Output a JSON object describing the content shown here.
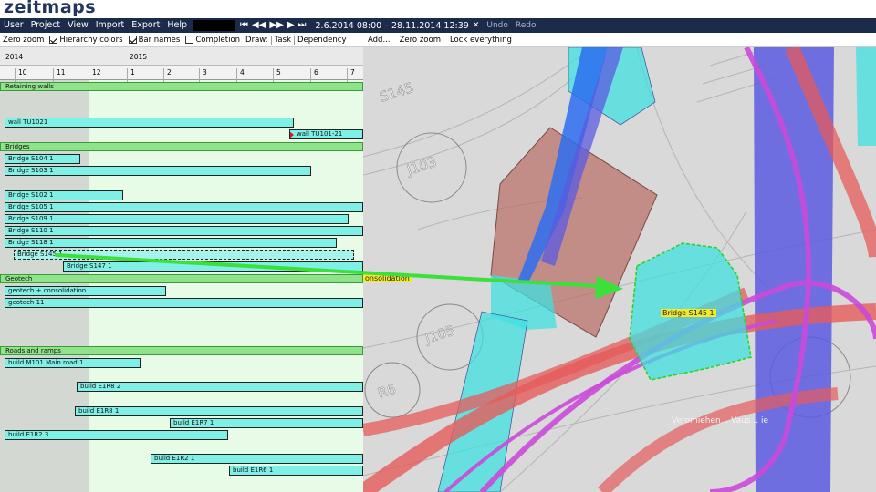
{
  "app": {
    "logo": "zeitmaps"
  },
  "menu": {
    "items": [
      "User",
      "Project",
      "View",
      "Import",
      "Export",
      "Help"
    ],
    "date_range": "2.6.2014 08:00 – 28.11.2014 12:39",
    "close": "✕",
    "undo": "Undo",
    "redo": "Redo",
    "playback": [
      "⏮",
      "◀◀",
      "▶▶",
      "▶",
      "⏭"
    ]
  },
  "toolbar": {
    "zero_zoom": "Zero zoom",
    "hierarchy_colors": "Hierarchy colors",
    "hierarchy_colors_checked": true,
    "bar_names": "Bar names",
    "bar_names_checked": true,
    "completion": "Completion",
    "completion_checked": false,
    "draw": "Draw:",
    "task": "Task",
    "dependency": "Dependency"
  },
  "map_toolbar": {
    "add": "Add...",
    "zero_zoom": "Zero zoom",
    "lock": "Lock everything"
  },
  "timeline": {
    "years": [
      "2014",
      "2015"
    ],
    "months": [
      "10",
      "11",
      "12",
      "1",
      "2",
      "3",
      "4",
      "5",
      "6",
      "7"
    ]
  },
  "groups": {
    "retaining": "Retaining walls",
    "bridges": "Bridges",
    "geotech": "Geotech",
    "roads": "Roads and ramps"
  },
  "tasks": {
    "wall_tu1021": "wall TU1021",
    "wall_tu10121": "wall  TU101-21",
    "s1041": "Bridge S104 1",
    "s1031": "Bridge S103 1",
    "s1021": "Bridge S102 1",
    "s1051": "Bridge S105 1",
    "s1091": "Bridge S109 1",
    "s1101": "Bridge S110 1",
    "s1181": "Bridge S118 1",
    "s1451": "Bridge S145 1",
    "s1471": "Bridge S147 1",
    "geotech_cons": "geotech + consolidation",
    "geotech11": "geotech 11",
    "m101": "build M101 Main road 1",
    "e1r82": "build E1R8 2",
    "e1r81": "build E1R8 1",
    "e1r71": "build E1R7 1",
    "e1r23": "build E1R2 3",
    "e1r21": "build E1R2 1",
    "e1r61": "build E1R6 1"
  },
  "map": {
    "labels": {
      "s145": "S145",
      "j103": "J103",
      "j105": "J105",
      "r6": "R6"
    },
    "bridge_label": "Bridge S145 1",
    "cons_label": "onsolidation",
    "street": "Veromiehen... Vaus... ie"
  },
  "colors": {
    "menu_bg": "#1c2b4a",
    "task_fill": "#7ff0e6",
    "group_fill": "#8fe38a",
    "arrow": "#3be03a",
    "road_red": "#e65b5b",
    "road_purple": "#c94ad9",
    "bridge_blue": "#5a5ae0",
    "building_brown": "#b86b64"
  }
}
